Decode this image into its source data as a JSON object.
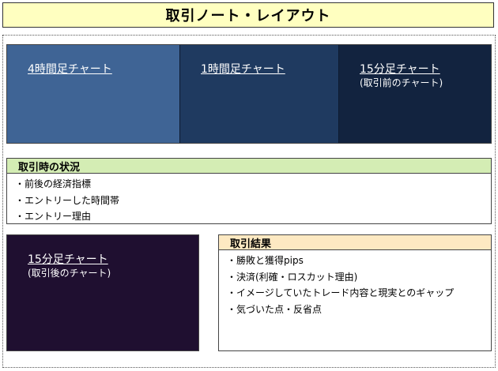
{
  "title": "取引ノート・レイアウト",
  "charts_top": [
    {
      "label": "4時間足チャート",
      "note": "",
      "color": "#3f6495"
    },
    {
      "label": "1時間足チャート",
      "note": "",
      "color": "#1f3a60"
    },
    {
      "label": "15分足チャート",
      "note": "(取引前のチャート)",
      "color": "#12233f"
    }
  ],
  "status": {
    "heading": "取引時の状況",
    "items": [
      "・前後の経済指標",
      "・エントリーした時間帯",
      "・エントリー理由"
    ]
  },
  "chart_after": {
    "label": "15分足チャート",
    "note": "(取引後のチャート)",
    "color": "#1f0f30"
  },
  "result": {
    "heading": "取引結果",
    "items": [
      "・勝敗と獲得pips",
      "・決済(利確・ロスカット理由)",
      "・イメージしていたトレード内容と現実とのギャップ",
      "・気づいた点・反省点"
    ]
  },
  "colors": {
    "title_bg": "#ffffc0",
    "status_header_bg": "#d4edb4",
    "result_header_bg": "#fde9c2"
  }
}
